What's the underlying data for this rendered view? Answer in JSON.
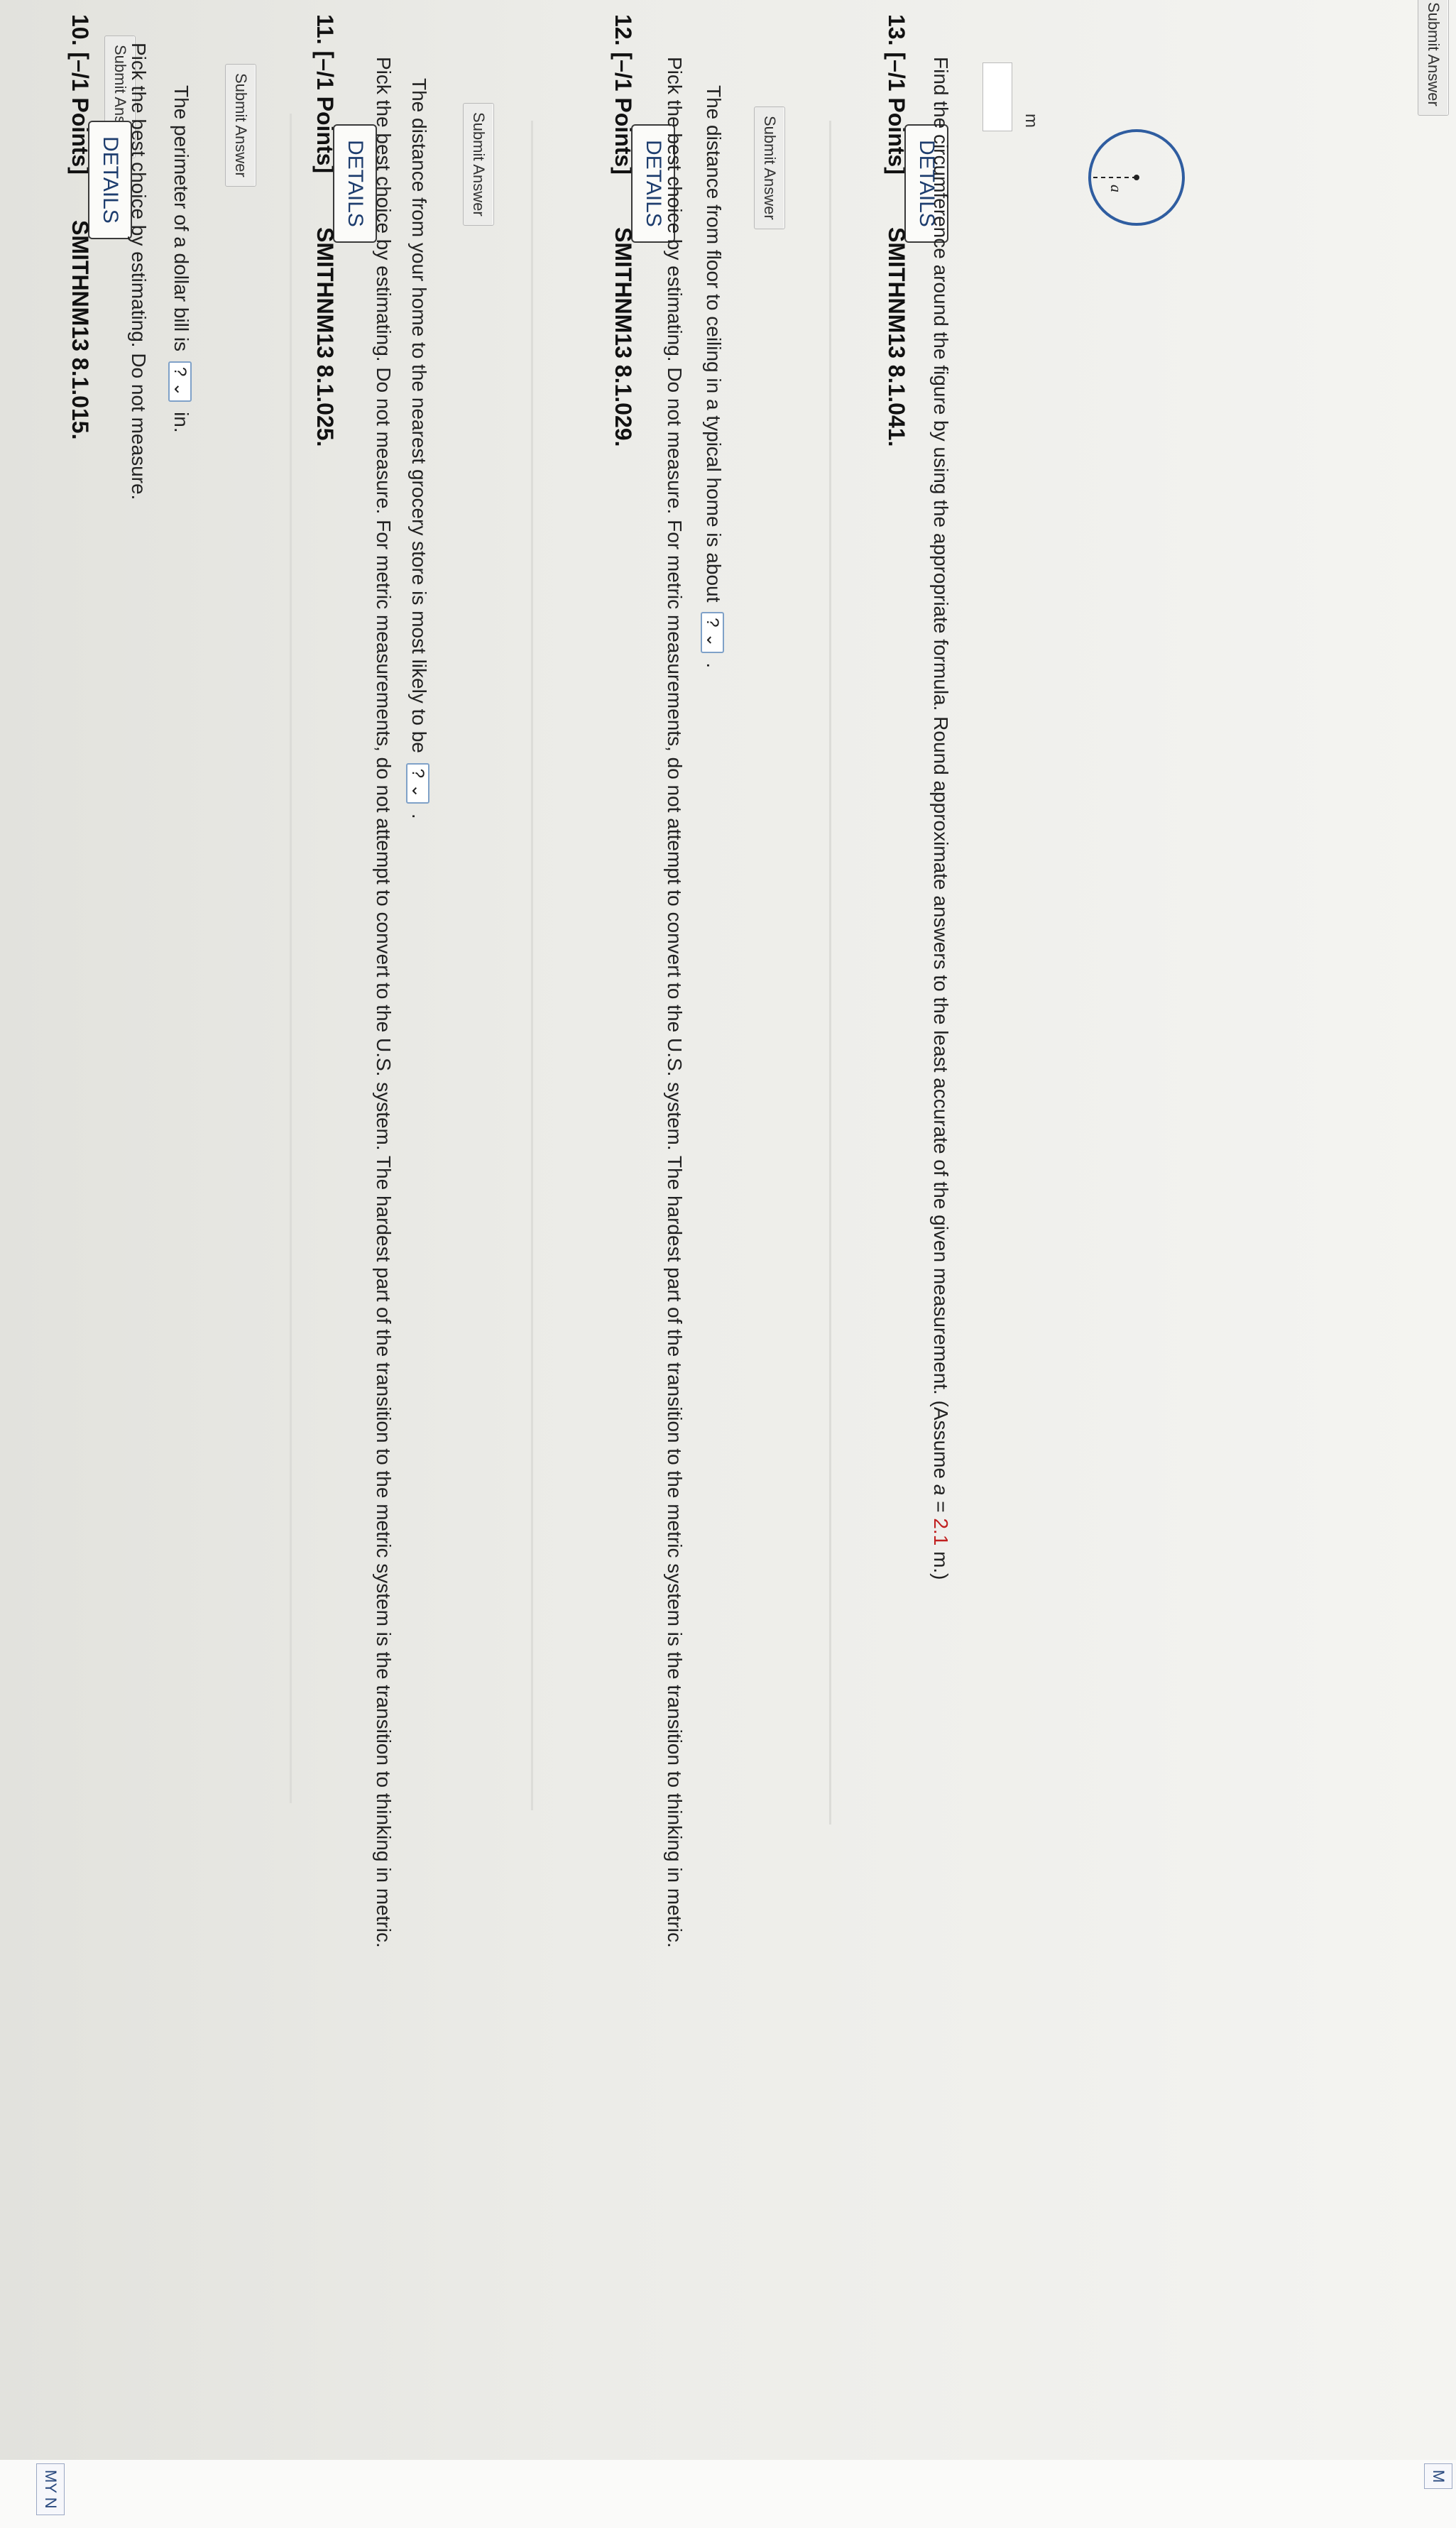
{
  "top_submit_label": "Submit Answer",
  "questions": [
    {
      "number": "10.",
      "points": "[–/1 Points]",
      "details_label": "DETAILS",
      "code": "SMITHNM13 8.1.015.",
      "prompt": "Pick the best choice by estimating. Do not measure.",
      "line_before": "The perimeter of a dollar bill is",
      "select_value": "?",
      "line_after": "in.",
      "submit_label": "Submit Answer"
    },
    {
      "number": "11.",
      "points": "[–/1 Points]",
      "details_label": "DETAILS",
      "code": "SMITHNM13 8.1.025.",
      "prompt": "Pick the best choice by estimating. Do not measure. For metric measurements, do not attempt to convert to the U.S. system. The hardest part of the transition to the metric system is the transition to thinking in metric.",
      "line_before": "The distance from your home to the nearest grocery store is most likely to be",
      "select_value": "?",
      "line_after": ".",
      "submit_label": "Submit Answer"
    },
    {
      "number": "12.",
      "points": "[–/1 Points]",
      "details_label": "DETAILS",
      "code": "SMITHNM13 8.1.029.",
      "prompt": "Pick the best choice by estimating. Do not measure. For metric measurements, do not attempt to convert to the U.S. system. The hardest part of the transition to the metric system is the transition to thinking in metric.",
      "line_before": "The distance from floor to ceiling in a typical home is about",
      "select_value": "?",
      "line_after": ".",
      "submit_label": "Submit Answer"
    },
    {
      "number": "13.",
      "points": "[–/1 Points]",
      "details_label": "DETAILS",
      "code": "SMITHNM13 8.1.041.",
      "prompt_before": "Find the circumference around the figure by using the appropriate formula. Round approximate answers to the least accurate of the given measurement. (Assume ",
      "prompt_var": "a",
      "prompt_eq": " = ",
      "prompt_value": "2.1",
      "prompt_after": " m.)",
      "unit": "m",
      "figure_label": "a",
      "submit_label": "Submit Answer"
    }
  ],
  "edge_button_1": "M",
  "edge_button_2": "MY N"
}
